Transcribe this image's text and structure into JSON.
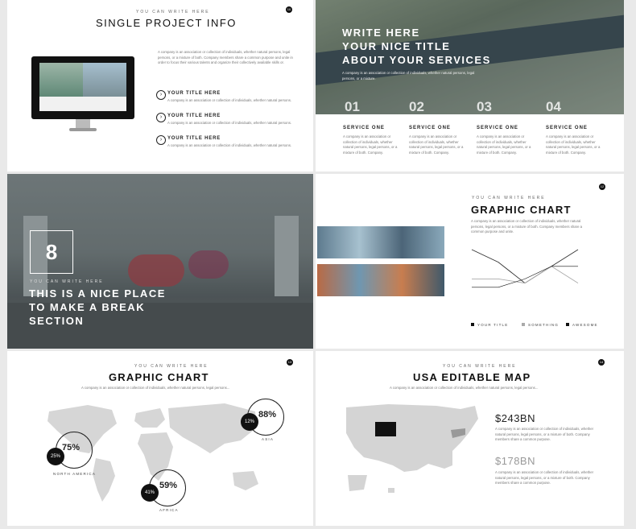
{
  "slide1": {
    "eyebrow": "YOU CAN WRITE HERE",
    "title": "SINGLE PROJECT INFO",
    "page_num": "10",
    "body": "A company is an association or collection of individuals, whether natural persons, legal persons, or a mixture of both. Company members share a common purpose and unite in order to focus their various talents and organize their collectively available skills or.",
    "items": [
      {
        "title": "YOUR TITLE HERE",
        "text": "A company is an association or collection of individuals, whether natural persons."
      },
      {
        "title": "YOUR TITLE HERE",
        "text": "A company is an association or collection of individuals, whether natural persons."
      },
      {
        "title": "YOUR TITLE HERE",
        "text": "A company is an association or collection of individuals, whether natural persons."
      }
    ]
  },
  "slide2": {
    "title_lines": [
      "WRITE HERE",
      "YOUR NICE TITLE",
      "ABOUT YOUR SERVICES"
    ],
    "subtext": "A company is an association or collection of individuals, whether natural persons, legal persons, or a mixture.",
    "services": [
      {
        "num": "01",
        "title": "SERVICE ONE",
        "text": "A company is an association or collection of individuals, whether natural persons, legal persons, or a mixture of both. Company."
      },
      {
        "num": "02",
        "title": "SERVICE ONE",
        "text": "A company is an association or collection of individuals, whether natural persons, legal persons, or a mixture of both. Company."
      },
      {
        "num": "03",
        "title": "SERVICE ONE",
        "text": "A company is an association or collection of individuals, whether natural persons, legal persons, or a mixture of both. Company."
      },
      {
        "num": "04",
        "title": "SERVICE ONE",
        "text": "A company is an association or collection of individuals, whether natural persons, legal persons, or a mixture of both. Company."
      }
    ]
  },
  "slide3": {
    "number": "8",
    "eyebrow": "YOU CAN WRITE HERE",
    "title_lines": [
      "THIS IS A NICE PLACE",
      "TO MAKE A BREAK",
      "SECTION"
    ]
  },
  "slide4": {
    "eyebrow": "YOU CAN WRITE HERE",
    "title": "GRAPHIC CHART",
    "page_num": "12",
    "text": "A company is an association or collection of individuals, whether natural persons, legal persons, or a mixture of both. Company members share a common purpose and unite."
  },
  "slide5": {
    "eyebrow": "YOU CAN WRITE HERE",
    "title": "GRAPHIC CHART",
    "page_num": "13",
    "text": "A company is an association or collection of individuals, whether natural persons, legal persons..."
  },
  "slide6": {
    "eyebrow": "YOU CAN WRITE HERE",
    "title": "USA EDITABLE MAP",
    "page_num": "14",
    "text": "A company is an association or collection of individuals, whether natural persons, legal persons...",
    "stats": [
      {
        "value": "$243BN",
        "text": "A company is an association or collection of individuals, whether natural persons, legal persons, or a mixture of both. Company members share a common purpose."
      },
      {
        "value": "$178BN",
        "text": "A company is an association or collection of individuals, whether natural persons, legal persons, or a mixture of both. Company members share a common purpose."
      }
    ]
  },
  "chart_data": [
    {
      "type": "line",
      "x": [
        1,
        2,
        3,
        4,
        5
      ],
      "series": [
        {
          "name": "YOUR TITLE",
          "values": [
            10,
            7,
            2,
            6,
            10
          ]
        },
        {
          "name": "SOMETHING",
          "values": [
            3,
            3,
            2,
            6,
            2
          ]
        },
        {
          "name": "AWESOME",
          "values": [
            1,
            1,
            3,
            6,
            6
          ]
        }
      ],
      "legend_position": "bottom"
    },
    {
      "type": "pie",
      "series": [
        {
          "name": "NORTH AMERICA",
          "inner": "25%",
          "outer": "75%"
        },
        {
          "name": "AFRICA",
          "inner": "41%",
          "outer": "59%"
        },
        {
          "name": "ASIA",
          "inner": "12%",
          "outer": "88%"
        }
      ]
    }
  ],
  "colors": {
    "dark": "#111111",
    "mid": "#555555",
    "light": "#aaaaaa",
    "map": "#d4d4d4"
  }
}
